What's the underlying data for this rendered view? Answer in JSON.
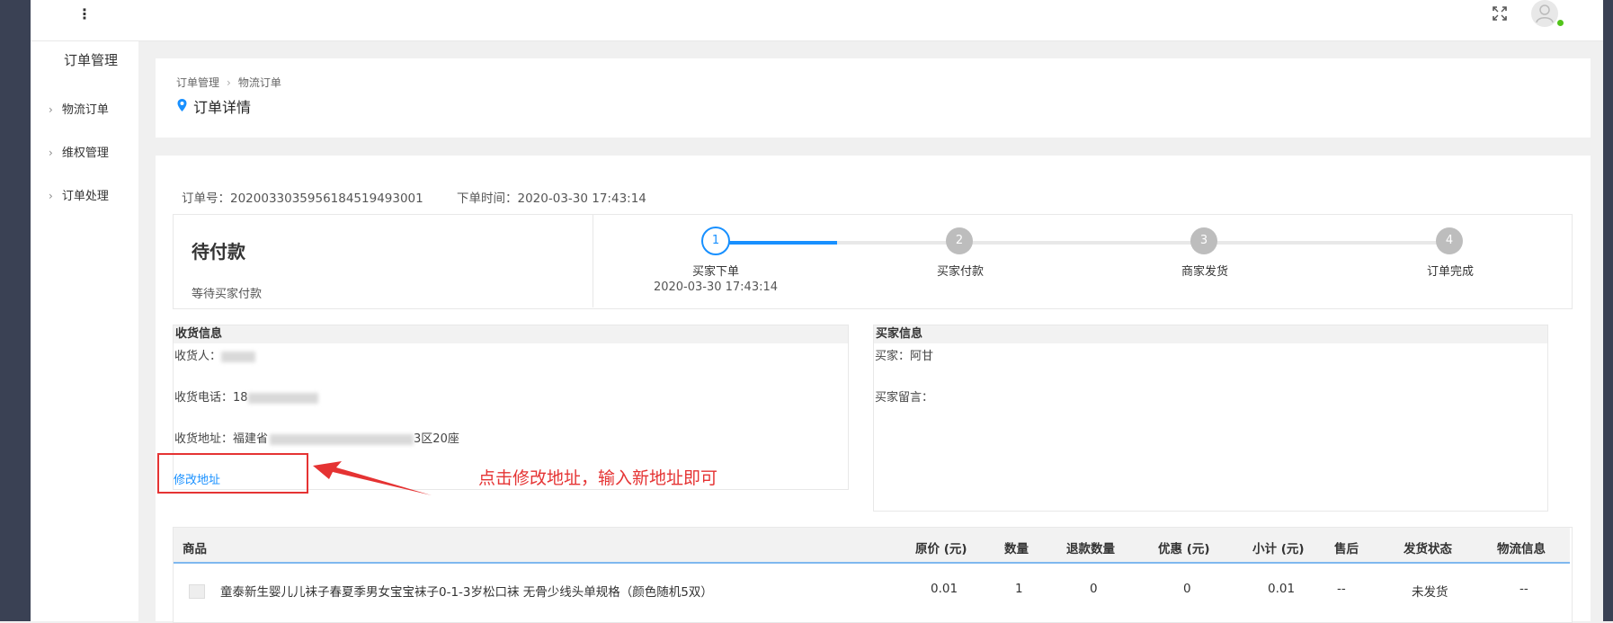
{
  "header": {
    "kebab": "⋮"
  },
  "sidebar": {
    "title": "订单管理",
    "items": [
      {
        "label": "物流订单"
      },
      {
        "label": "维权管理"
      },
      {
        "label": "订单处理"
      }
    ]
  },
  "breadcrumb": {
    "root": "订单管理",
    "current": "物流订单"
  },
  "page": {
    "title": "订单详情"
  },
  "order": {
    "number_label": "订单号：",
    "number": "2020033035956184519493001",
    "time_label": "下单时间：",
    "time": "2020-03-30 17:43:14"
  },
  "status": {
    "title": "待付款",
    "subtitle": "等待买家付款",
    "steps": [
      {
        "num": "1",
        "label": "买家下单",
        "time": "2020-03-30 17:43:14"
      },
      {
        "num": "2",
        "label": "买家付款"
      },
      {
        "num": "3",
        "label": "商家发货"
      },
      {
        "num": "4",
        "label": "订单完成"
      }
    ],
    "progress": 0.5
  },
  "shipping": {
    "heading": "收货信息",
    "receiver_label": "收货人：",
    "phone_label": "收货电话：",
    "phone_visible": "18",
    "address_label": "收货地址：",
    "address_start": "福建省",
    "address_end": "3区20座",
    "modify_link": "修改地址"
  },
  "buyer": {
    "heading": "买家信息",
    "buyer_label": "买家：",
    "buyer_name": "阿甘",
    "message_label": "买家留言："
  },
  "annotation": {
    "text": "点击修改地址，输入新地址即可",
    "color": "#e53333"
  },
  "table": {
    "headers": [
      "商品",
      "原价 (元)",
      "数量",
      "退款数量",
      "优惠 (元)",
      "小计 (元)",
      "售后",
      "发货状态",
      "物流信息"
    ],
    "rows": [
      {
        "product": "童泰新生婴儿儿袜子春夏季男女宝宝袜子0-1-3岁松口袜 无骨少线头单规格（颜色随机5双）",
        "price": "0.01",
        "qty": "1",
        "refund_qty": "0",
        "discount": "0",
        "subtotal": "0.01",
        "after_sale": "--",
        "ship_status": "未发货",
        "logistics": "--"
      }
    ]
  },
  "colors": {
    "accent": "#1890ff",
    "sidebar_dark": "#3a4154",
    "online": "#52c41a"
  }
}
